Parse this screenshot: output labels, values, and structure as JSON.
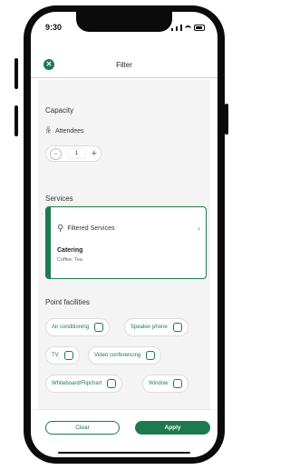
{
  "status": {
    "time": "9:30"
  },
  "header": {
    "close_icon": "close-icon",
    "title": "Filter"
  },
  "capacity": {
    "heading": "Capacity",
    "attendees_label": "Attendees",
    "quantity": "1",
    "minus_symbol": "−",
    "plus_symbol": "+"
  },
  "services": {
    "heading": "Services",
    "card_title": "Filtered Services",
    "chevron": "›",
    "item_title": "Catering",
    "item_subtitle": "Coffee; Tea"
  },
  "facilities": {
    "heading": "Point facilities",
    "items": [
      {
        "label": "Air conditioning"
      },
      {
        "label": "Speaker phone"
      },
      {
        "label": "TV"
      },
      {
        "label": "Video conferencing"
      },
      {
        "label": "Whiteboard/Flipchart"
      },
      {
        "label": "Window"
      }
    ]
  },
  "footer": {
    "clear_label": "Clear",
    "apply_label": "Apply"
  },
  "colors": {
    "accent": "#1d7a4f",
    "background": "#f4f4f4"
  }
}
